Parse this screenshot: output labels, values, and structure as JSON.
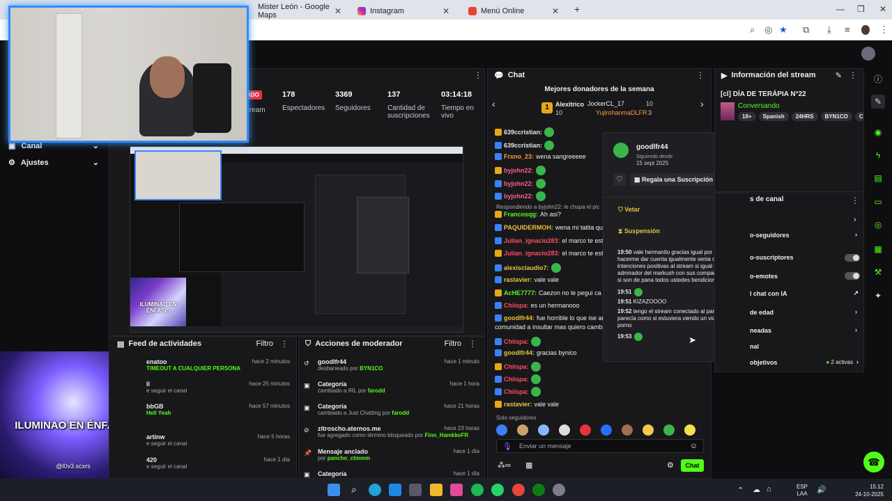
{
  "browser": {
    "tabs": [
      {
        "label": "Mister León - Google Maps",
        "icon": "maps-icon"
      },
      {
        "label": "Instagram",
        "icon": "instagram-icon"
      },
      {
        "label": "Menú Online",
        "icon": "menu-icon"
      }
    ],
    "new_tab": "+"
  },
  "sidebar": {
    "items": [
      {
        "label": "Canal"
      },
      {
        "label": "Ajustes"
      }
    ]
  },
  "stats": {
    "live_badge": "ADO",
    "stream_label": "tream",
    "items": [
      {
        "value": "178",
        "label": "Espectadores"
      },
      {
        "value": "3369",
        "label": "Seguidores"
      },
      {
        "value": "137",
        "label": "Cantidad de suscripciones"
      },
      {
        "value": "03:14:18",
        "label": "Tiempo en vivo"
      }
    ]
  },
  "overlay": {
    "title": "ILUMINAO EN ÉNFASIS",
    "handle": "@l0v3.scxrs",
    "small_title": "ILUMINAO EN ÉNFASIS"
  },
  "chat": {
    "title": "Chat",
    "donors_title": "Mejores donadores de la semana",
    "donors": [
      {
        "rank": "1",
        "name": "Alexitrico",
        "amount": "10"
      },
      {
        "name": "JockerCL_17",
        "amount": "10"
      },
      {
        "name": "YujirohanmaDLFR",
        "amount": "3"
      }
    ],
    "messages": [
      {
        "user": "639ccristian:",
        "text": "",
        "color": "#e6e6e6"
      },
      {
        "user": "639ccristian:",
        "text": "",
        "color": "#e6e6e6"
      },
      {
        "user": "Frxno_23:",
        "text": "wena sangreeeee",
        "color": "#ff9a3c"
      },
      {
        "user": "byjohn22:",
        "text": "",
        "color": "#ff5e8a"
      },
      {
        "user": "byjohn22:",
        "text": "",
        "color": "#ff5e8a"
      },
      {
        "user": "byjohn22:",
        "text": "",
        "color": "#ff5e8a"
      },
      {
        "user": "Francosqg:",
        "text": "Ah asi?",
        "color": "#53fc18"
      },
      {
        "user": "PAQUIDERMOH:",
        "text": "wena mi tatita qu",
        "color": "#e6c43b"
      },
      {
        "user": "Julian_ignacio283:",
        "text": "el marco te estab",
        "color": "#ff4d5e"
      },
      {
        "user": "Julian_ignacio283:",
        "text": "el marco te estab",
        "color": "#ff4d5e"
      },
      {
        "user": "alexisclaudio7:",
        "text": "",
        "color": "#e6c43b"
      },
      {
        "user": "rastavier:",
        "text": "vale vale",
        "color": "#e6c43b"
      },
      {
        "user": "AcHE7777:",
        "text": "Caezon no le pegui ca",
        "color": "#53fc18"
      },
      {
        "user": "Chiispa:",
        "text": "es un hermanooo",
        "color": "#ff4d5e"
      },
      {
        "user": "goodlfr44:",
        "text": "fue horrible lo que ise anterio",
        "color": "#e6c43b"
      },
      {
        "user": "",
        "text": "comunidad a insultar mas quiero cambair",
        "color": "#e6e6e6"
      },
      {
        "user": "Chiispa:",
        "text": "",
        "color": "#ff4d5e"
      },
      {
        "user": "goodlfr44:",
        "text": "gracias bynico",
        "color": "#e6c43b"
      },
      {
        "user": "Chiispa:",
        "text": "",
        "color": "#ff4d5e"
      },
      {
        "user": "Chiispa:",
        "text": "",
        "color": "#ff4d5e"
      },
      {
        "user": "Chiispa:",
        "text": "",
        "color": "#ff4d5e"
      },
      {
        "user": "rastavier:",
        "text": "vale vale",
        "color": "#e6c43b"
      }
    ],
    "reply_note": "Respondiendo a byjohn22: le chupa el pic",
    "followers_only": "Solo seguidores",
    "input_placeholder": "Enviar un mensaje",
    "send_label": "Chat"
  },
  "popup": {
    "username": "goodlfr44",
    "following_since_label": "Siguiendo desde",
    "following_since": "15 sept 2025",
    "gift_label": "Regala una Suscripción",
    "veto_label": "Vetar",
    "suspension_label": "Suspensión",
    "log": [
      {
        "time": "19:50",
        "text": "vale hermanito gracias igual por hacerme dar cuenta igualmente venia con intenciones positivas al stream si igual soy un admirador del markush con sus compañeros si son de pana todos ustedes bendiciones"
      },
      {
        "time": "19:51",
        "text": ""
      },
      {
        "time": "19:51",
        "text": "KIZAZOOOO"
      },
      {
        "time": "19:52",
        "text": "tengo el stream conectado al parlante y parecía como si estuviera viendo un video porno"
      },
      {
        "time": "19:53",
        "text": ""
      }
    ]
  },
  "stream_info": {
    "title": "Información del stream",
    "stream_title": "[cl] DÍA DE TERÁPIA N°22",
    "category": "Conversando",
    "tags": [
      "18+",
      "Spanish",
      "24HRS",
      "BYN1CO",
      "Chile"
    ]
  },
  "channel_settings": {
    "title": "s de canal",
    "items": [
      {
        "label": "o-seguidores"
      },
      {
        "label": "o-suscriptores"
      },
      {
        "label": "o-emotes"
      },
      {
        "label": "l chat con IA"
      },
      {
        "label": "de edad"
      },
      {
        "label": "neadas"
      },
      {
        "label": "nal"
      },
      {
        "label": "objetivos",
        "extra": "2 activas"
      }
    ]
  },
  "activity_feed": {
    "title": "Feed de actividades",
    "filter": "Filtro",
    "items": [
      {
        "user": "enatoo",
        "sub": "TIMEOUT A CUALQUIER PERSONA",
        "time": "hace 2 minutos"
      },
      {
        "user": "ll",
        "sub": "e seguir el canal",
        "time": "hace 25 minutos"
      },
      {
        "user": "bbGB",
        "sub": "Hell Yeah",
        "time": "hace 57 minutos"
      },
      {
        "user": "artinw",
        "sub": "e seguir el canal",
        "time": "hace 5 horas"
      },
      {
        "user": "420",
        "sub": "e seguir el canal",
        "time": "hace 1 día"
      }
    ]
  },
  "mod_actions": {
    "title": "Acciones de moderador",
    "filter": "Filtro",
    "items": [
      {
        "title": "goodlfr44",
        "sub": "desbaneado por",
        "who": "BYN1CO",
        "time": "hace 1 minuto"
      },
      {
        "title": "Categoría",
        "sub": "cambiado a IRL por",
        "who": "farodd",
        "time": "hace 1 hora"
      },
      {
        "title": "Categoría",
        "sub": "cambiado a Just Chatting por",
        "who": "farodd",
        "time": "hace 21 horas"
      },
      {
        "title": "zitroscho.aternos.me",
        "sub": "fue agregado como término bloqueado por",
        "who": "Finn_HamkkeFR",
        "time": "hace 23 horas"
      },
      {
        "title": "Mensaje anclado",
        "sub": "por",
        "who": "pancho_ctmmm",
        "time": "hace 1 día"
      },
      {
        "title": "Categoría",
        "sub": "",
        "who": "",
        "time": "hace 1 día"
      }
    ]
  },
  "taskbar": {
    "lang": "ESP",
    "lang2": "LAA",
    "time": "15:12",
    "date": "24-10-2025"
  },
  "colors": {
    "accent": "#53fc18",
    "panel": "#18181b",
    "bg": "#0e0e10"
  }
}
